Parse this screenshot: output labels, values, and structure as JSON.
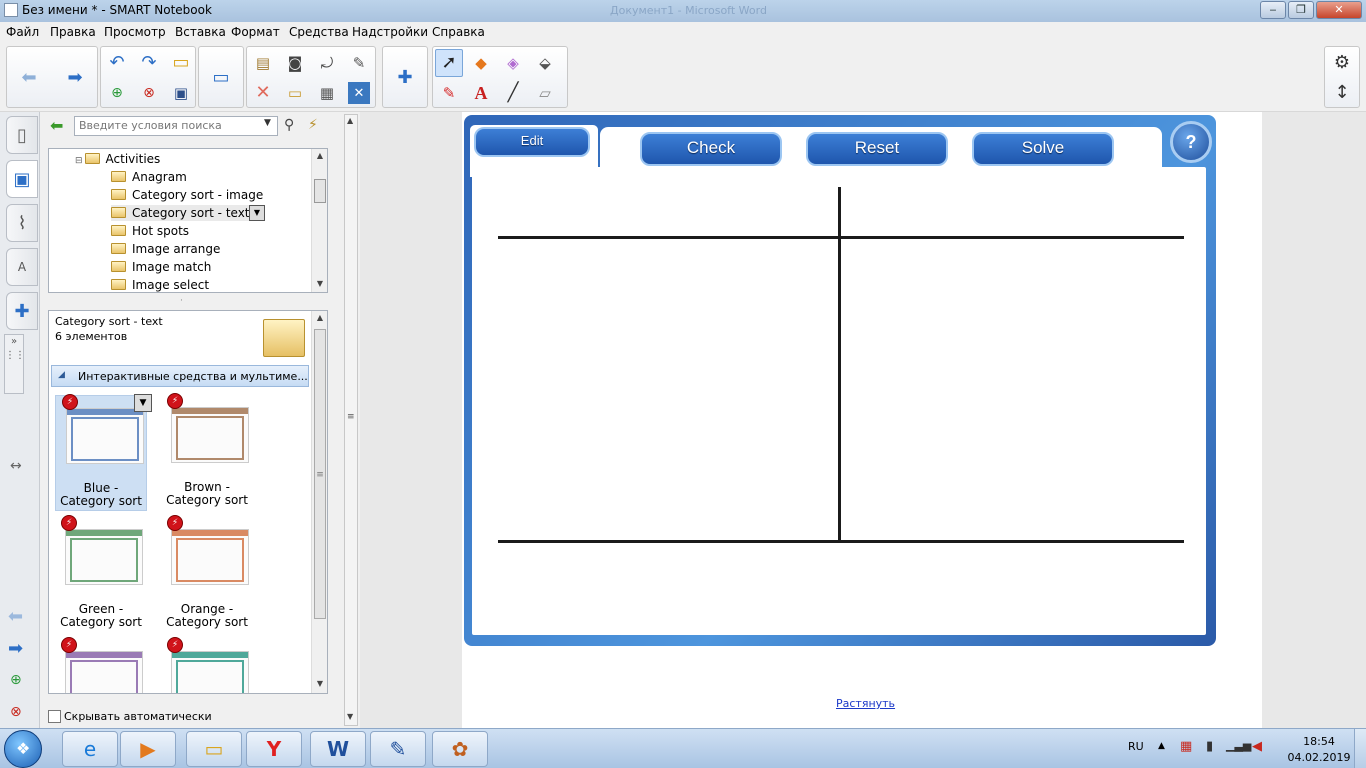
{
  "window": {
    "title": "Без имени * - SMART Notebook",
    "background_title": "Документ1 - Microsoft Word",
    "controls": [
      "‒",
      "❐",
      "✕"
    ]
  },
  "menu": [
    "Файл",
    "Правка",
    "Просмотр",
    "Вставка",
    "Формат",
    "Средства",
    "Надстройки",
    "Справка"
  ],
  "search": {
    "placeholder": "Введите условия поиска"
  },
  "tree": {
    "root": "Activities",
    "items": [
      "Anagram",
      "Category sort - image",
      "Category sort - text",
      "Hot spots",
      "Image arrange",
      "Image match",
      "Image select"
    ],
    "selected": "Category sort - text"
  },
  "gallery": {
    "title": "Category sort - text",
    "count": "6 элементов",
    "section": "Интерактивные средства и мультиме...",
    "items": [
      {
        "label": "Blue - Category sort",
        "color": "#6c8fc4"
      },
      {
        "label": "Brown - Category sort",
        "color": "#b0896b"
      },
      {
        "label": "Green - Category sort",
        "color": "#6fa77a"
      },
      {
        "label": "Orange - Category sort",
        "color": "#d98a63"
      },
      {
        "label": "",
        "color": "#9a7bb5"
      },
      {
        "label": "",
        "color": "#4fa89a"
      }
    ],
    "autohide": "Скрывать автоматически"
  },
  "widget": {
    "tabs": {
      "edit": "Edit",
      "check": "Check",
      "reset": "Reset",
      "solve": "Solve",
      "help": "?"
    }
  },
  "page": {
    "stretch_link": "Растянуть"
  },
  "tray": {
    "lang": "RU",
    "time": "18:54",
    "date": "04.02.2019"
  }
}
